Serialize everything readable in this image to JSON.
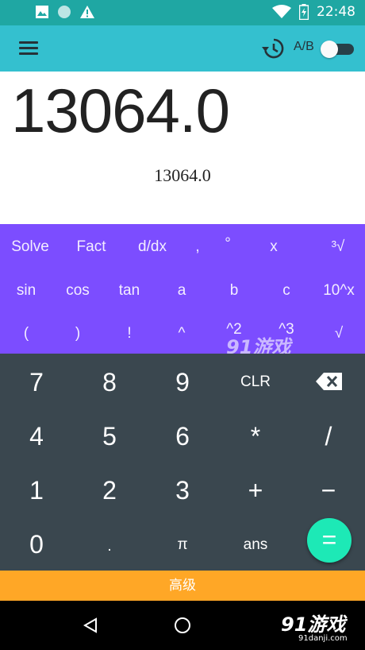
{
  "status_bar": {
    "time": "22:48",
    "icons": [
      "image-icon",
      "circle-icon",
      "warning-icon",
      "wifi-icon",
      "battery-icon"
    ]
  },
  "toolbar": {
    "ab_label": "A/B",
    "history_icon": "history-icon",
    "menu_icon": "hamburger-menu-icon"
  },
  "display": {
    "input": "13064.0",
    "result": "13064.0"
  },
  "advanced_pad": {
    "row1": [
      "Solve",
      "Fact",
      "d/dx",
      ",",
      "°",
      "x",
      "³√"
    ],
    "row2": [
      "sin",
      "cos",
      "tan",
      "a",
      "b",
      "c",
      "10^x"
    ],
    "row3": [
      "(",
      ")",
      "!",
      "^",
      "^2",
      "^3",
      "√"
    ]
  },
  "number_pad": {
    "row1": [
      "7",
      "8",
      "9",
      "CLR"
    ],
    "row2": [
      "4",
      "5",
      "6",
      "*",
      "/"
    ],
    "row3": [
      "1",
      "2",
      "3",
      "+",
      "−"
    ],
    "row4": [
      "0",
      ".",
      "π",
      "ans"
    ],
    "equals": "="
  },
  "bottom_bar": {
    "label": "高级"
  },
  "watermark": {
    "brand": "91游戏",
    "site": "91danji.com"
  },
  "colors": {
    "status_bar": "#1fa7a3",
    "toolbar": "#34c0cf",
    "advanced_pad": "#7c4dff",
    "number_pad": "#3a474f",
    "equals_button": "#1de9b6",
    "advanced_bar": "#ffa726"
  }
}
